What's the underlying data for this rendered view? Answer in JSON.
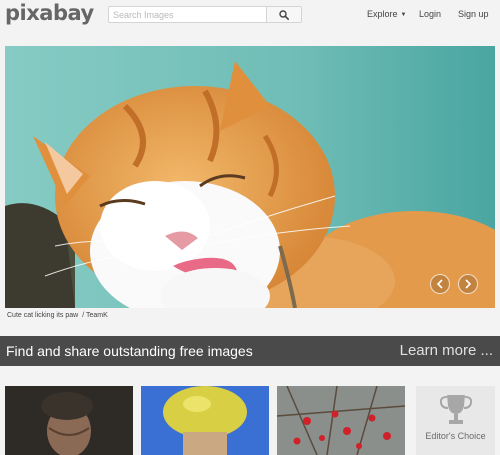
{
  "header": {
    "logo_text": "pixabay",
    "search_placeholder": "Search Images",
    "nav": {
      "explore": "Explore",
      "login": "Login",
      "signup": "Sign up"
    }
  },
  "hero": {
    "caption_title": "Cute cat licking its paw",
    "caption_author": "/ TeamK"
  },
  "banner": {
    "title": "Find and share outstanding free images",
    "link": "Learn more ..."
  },
  "thumbnails": {
    "editors_choice_label": "Editor's Choice"
  },
  "colors": {
    "background": "#f3f3f3",
    "banner": "#4a4a4a",
    "hero_sky": "#7ac4bd",
    "cat_orange": "#e39a47"
  }
}
